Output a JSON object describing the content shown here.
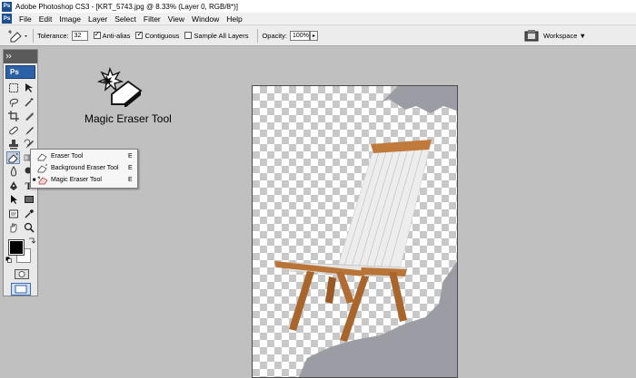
{
  "window": {
    "title": "Adobe Photoshop CS3 - [KRT_5743.jpg @ 8.33% (Layer 0, RGB/8*)]"
  },
  "menu": [
    "File",
    "Edit",
    "Image",
    "Layer",
    "Select",
    "Filter",
    "View",
    "Window",
    "Help"
  ],
  "options": {
    "tolerance_label": "Tolerance:",
    "tolerance_value": "32",
    "anti_alias_label": "Anti-alias",
    "anti_alias_checked": true,
    "contiguous_label": "Contiguous",
    "contiguous_checked": true,
    "sample_all_layers_label": "Sample All Layers",
    "sample_all_layers_checked": false,
    "opacity_label": "Opacity:",
    "opacity_value": "100%",
    "workspace_label": "Workspace ▼"
  },
  "toolbox": {
    "ps_label": "Ps"
  },
  "flyout": {
    "items": [
      {
        "label": "Eraser Tool",
        "shortcut": "E",
        "selected": false
      },
      {
        "label": "Background Eraser Tool",
        "shortcut": "E",
        "selected": false
      },
      {
        "label": "Magic Eraser Tool",
        "shortcut": "E",
        "selected": true
      }
    ]
  },
  "tool_caption": "Magic Eraser Tool",
  "colors": {
    "accent": "#2c61a8",
    "canvas_gray": "#9c9ca4",
    "foreground": "#000000",
    "background": "#ffffff"
  }
}
